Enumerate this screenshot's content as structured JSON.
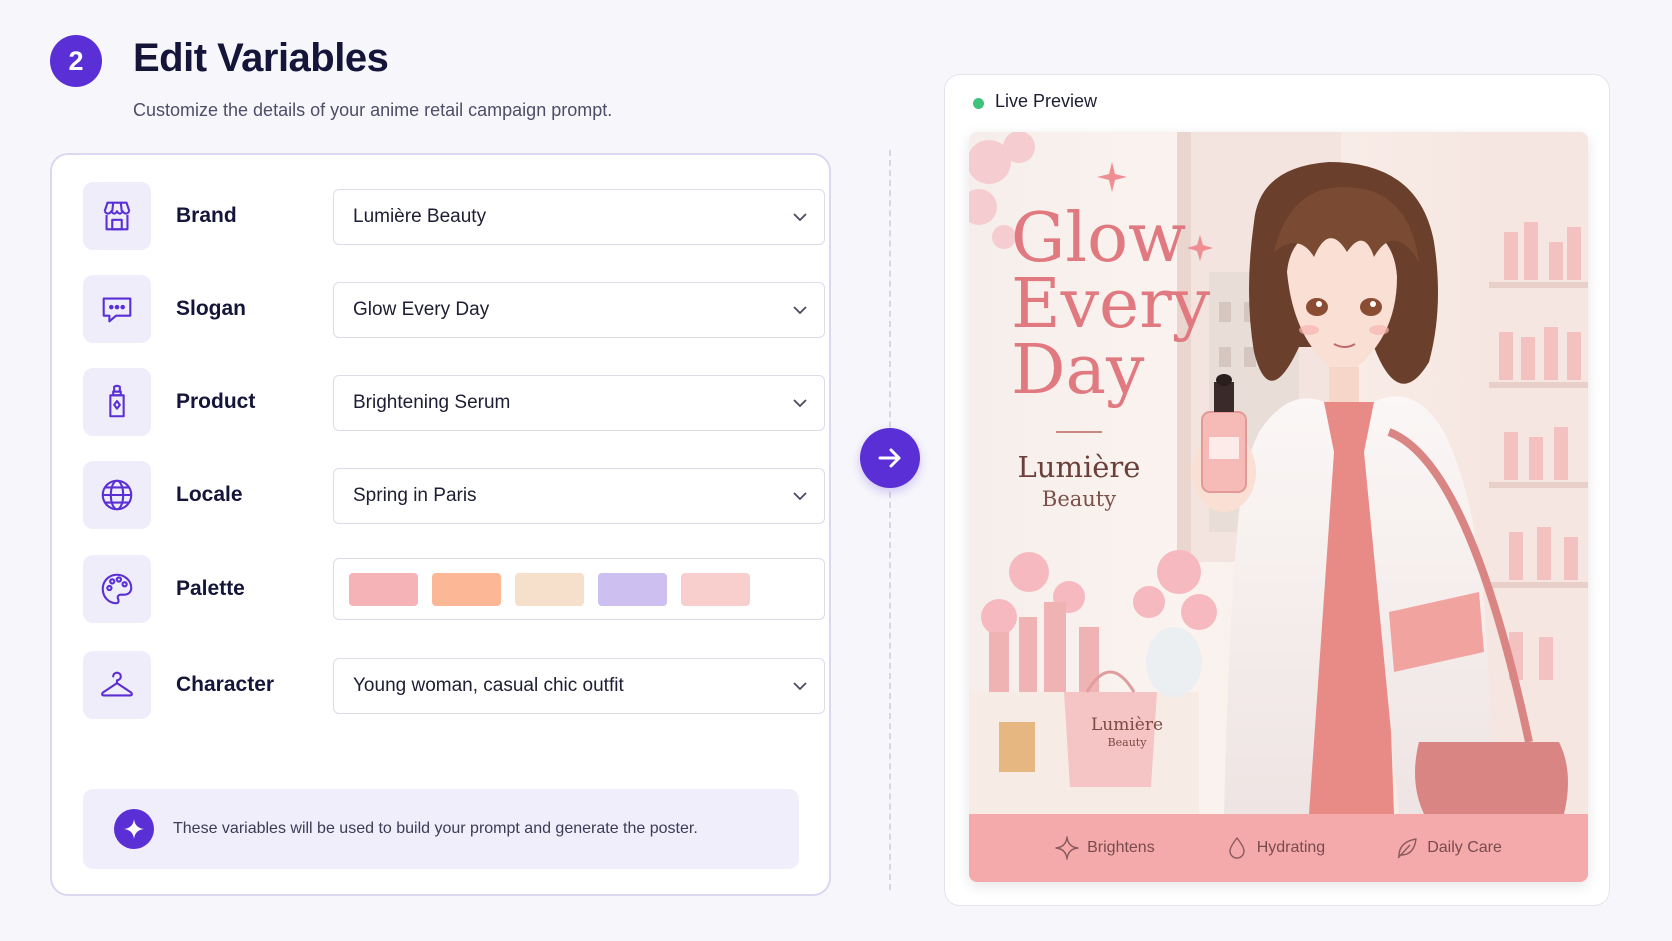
{
  "header": {
    "step_number": "2",
    "title": "Edit Variables",
    "subtitle": "Customize the details of your anime retail campaign prompt."
  },
  "form": {
    "rows": [
      {
        "label": "Brand",
        "value": "Lumière Beauty",
        "icon": "storefront-icon"
      },
      {
        "label": "Slogan",
        "value": "Glow Every Day",
        "icon": "chat-bubble-icon"
      },
      {
        "label": "Product",
        "value": "Brightening Serum",
        "icon": "serum-bottle-icon"
      },
      {
        "label": "Locale",
        "value": "Spring in Paris",
        "icon": "globe-icon"
      },
      {
        "label": "Palette",
        "icon": "palette-icon"
      },
      {
        "label": "Character",
        "value": "Young woman, casual chic outfit",
        "icon": "hanger-icon"
      }
    ],
    "palette_colors": [
      "#f6b3b7",
      "#fbb796",
      "#f6e0cc",
      "#cdbff0",
      "#f9cfcd"
    ],
    "info_text": "These variables will be used to build your prompt and generate the poster."
  },
  "preview": {
    "label": "Live Preview",
    "status_color": "#3fc27a",
    "poster": {
      "headline": [
        "Glow",
        "Every",
        "Day"
      ],
      "brand": "Lumière",
      "brand_sub": "Beauty",
      "bag_brand": "Lumière",
      "bag_brand_sub": "Beauty",
      "features": [
        {
          "label": "Brightens",
          "icon": "sparkle-icon"
        },
        {
          "label": "Hydrating",
          "icon": "droplet-icon"
        },
        {
          "label": "Daily Care",
          "icon": "leaf-icon"
        }
      ]
    }
  },
  "colors": {
    "accent": "#5a2fd6",
    "poster_pink": "#e07a80",
    "feature_bar": "#f4aaaa"
  }
}
